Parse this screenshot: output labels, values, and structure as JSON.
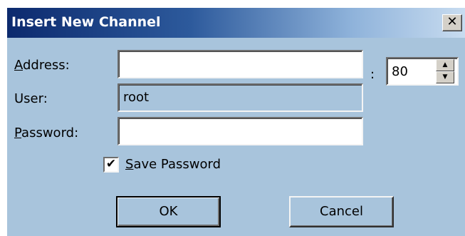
{
  "dialog": {
    "title": "Insert New Channel",
    "close_glyph": "✕"
  },
  "form": {
    "address": {
      "label_first": "A",
      "label_rest": "ddress:",
      "value": ""
    },
    "port": {
      "separator": ":",
      "value": "80"
    },
    "user": {
      "label": "User:",
      "value": "root"
    },
    "password": {
      "label_first": "P",
      "label_rest": "assword:",
      "value": ""
    },
    "save_password": {
      "label_first": "S",
      "label_rest": "ave Password",
      "checked": true,
      "check_glyph": "✔"
    }
  },
  "buttons": {
    "ok": "OK",
    "cancel": "Cancel"
  },
  "icons": {
    "spin_up": "spin-up-arrow",
    "spin_down": "spin-down-arrow"
  }
}
